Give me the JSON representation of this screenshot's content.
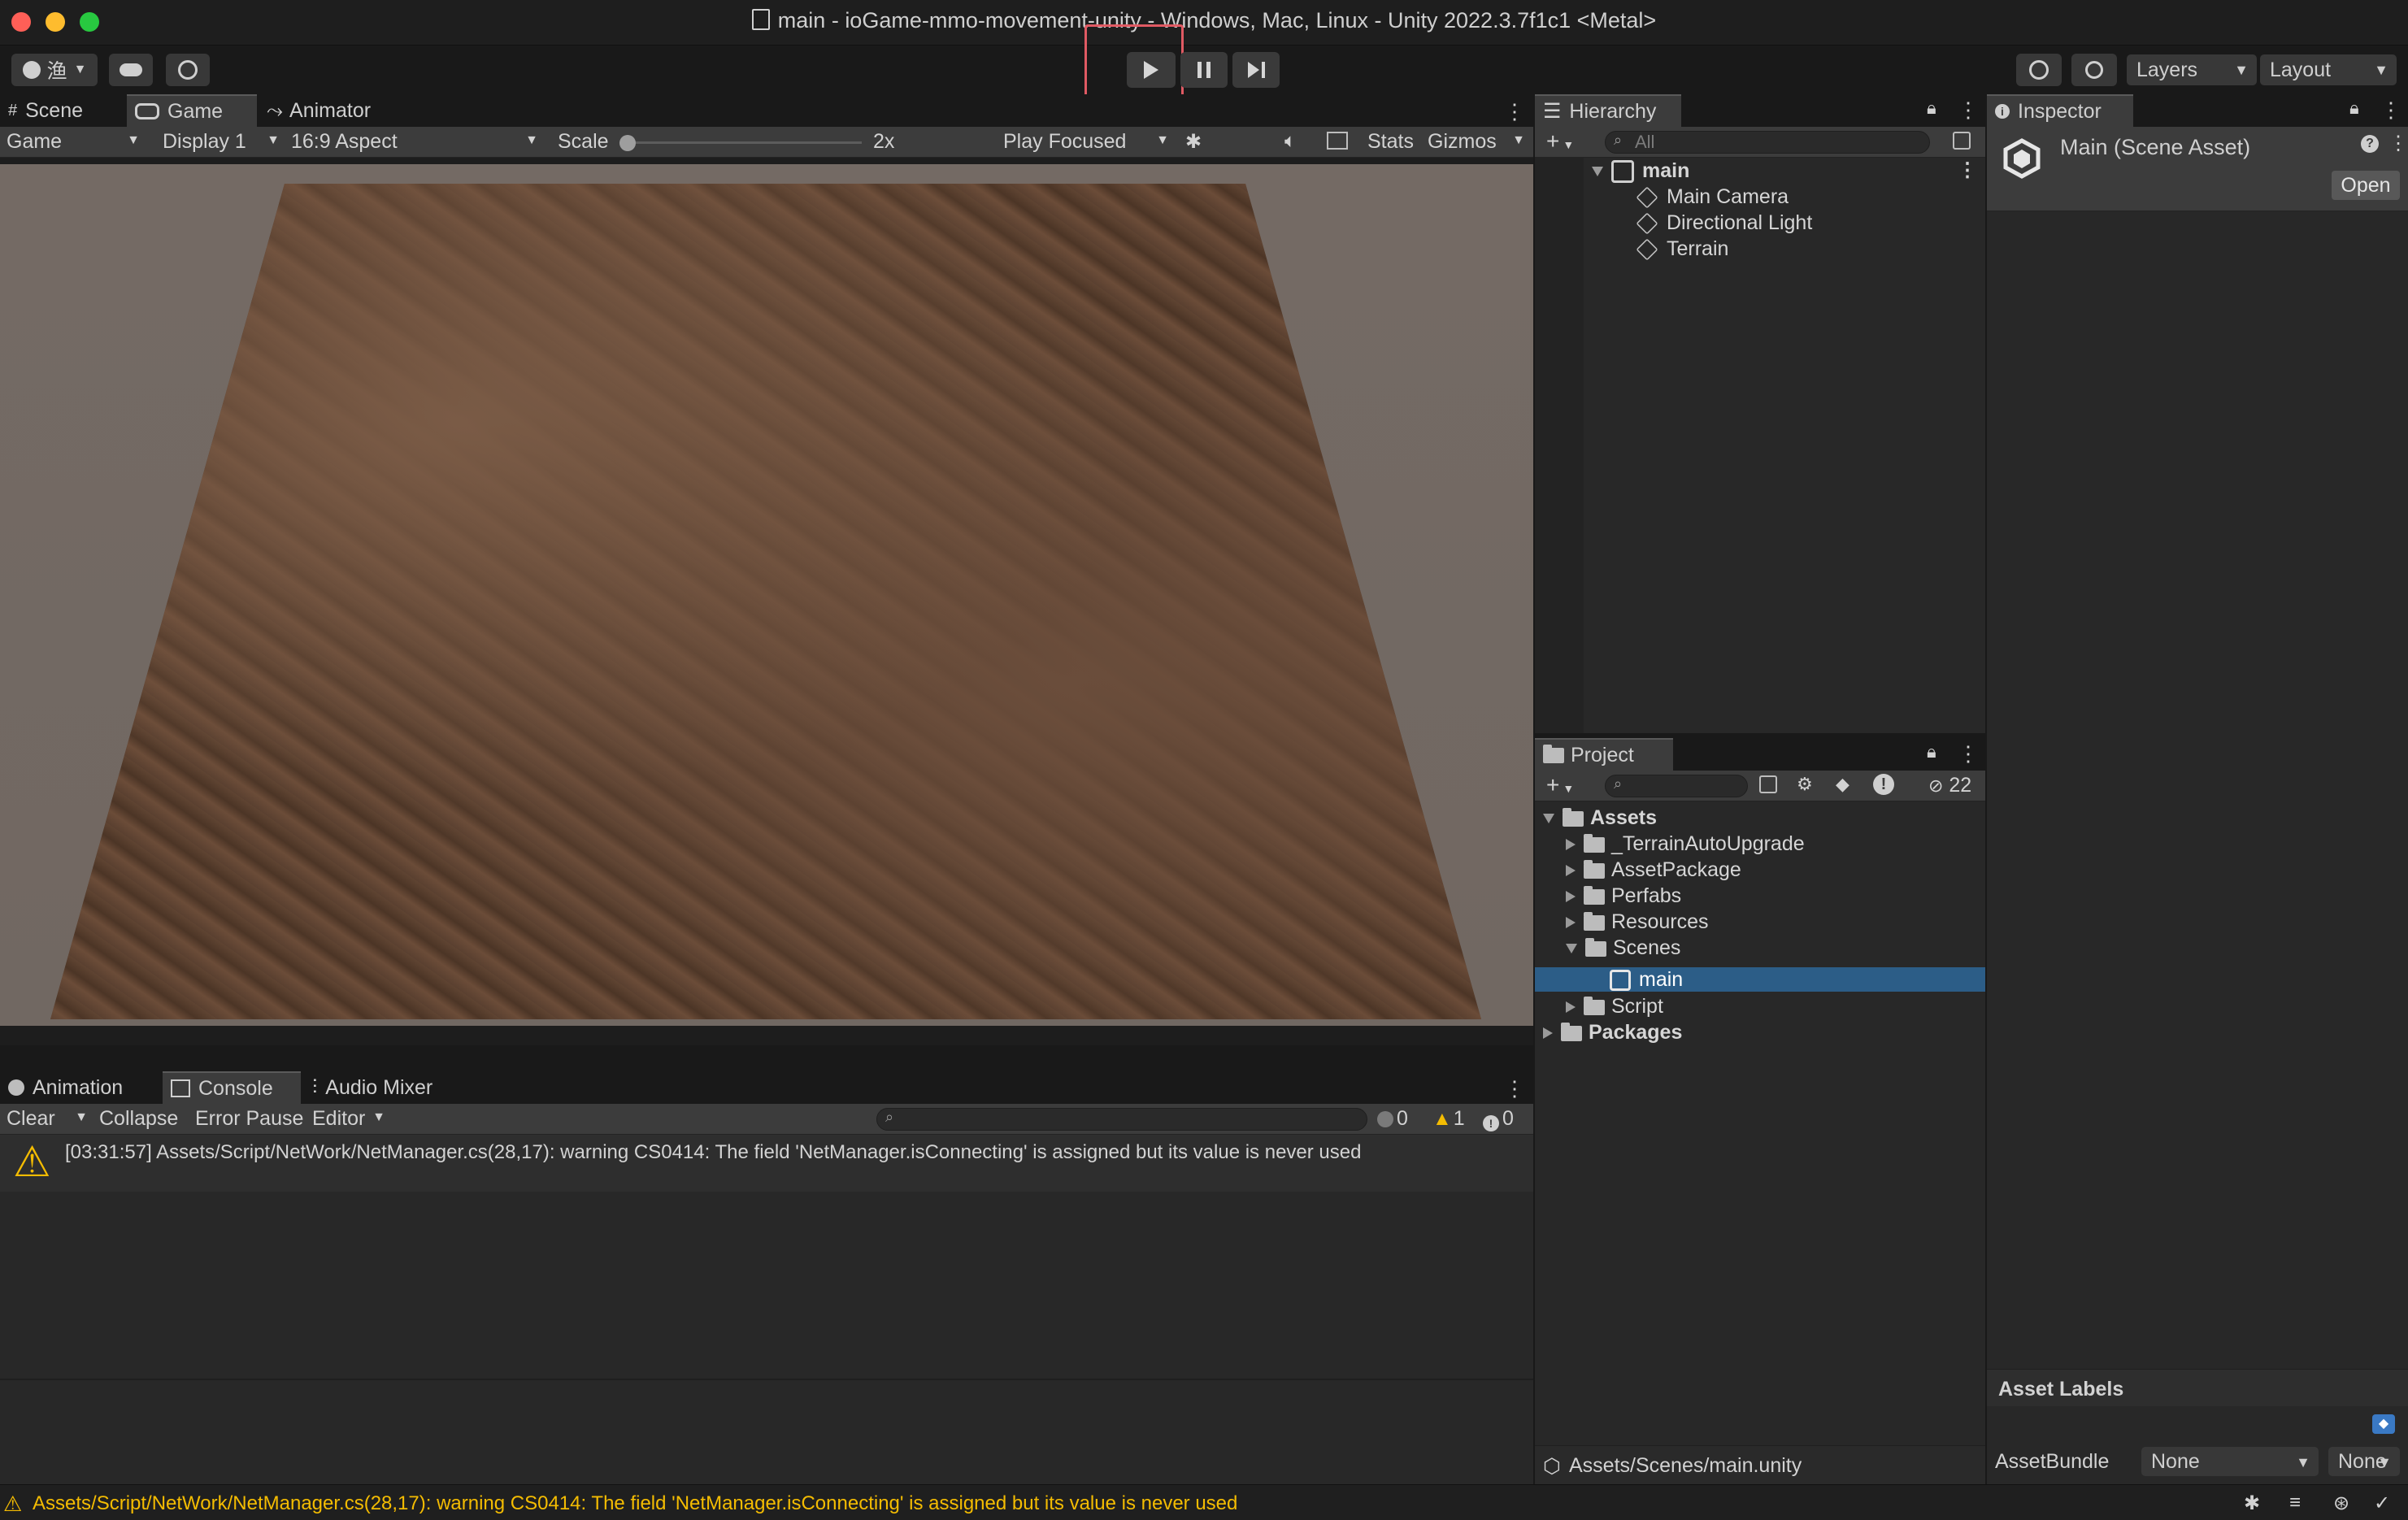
{
  "window": {
    "title": "main - ioGame-mmo-movement-unity - Windows, Mac, Linux - Unity 2022.3.7f1c1 <Metal>"
  },
  "toolbar": {
    "account_label": "渔",
    "layers_label": "Layers",
    "layout_label": "Layout"
  },
  "game_panel": {
    "tabs": [
      "Scene",
      "Game",
      "Animator"
    ],
    "view_select": "Game",
    "display_select": "Display 1",
    "aspect_select": "16:9 Aspect",
    "scale_label": "Scale",
    "scale_value": "2x",
    "play_mode_select": "Play Focused",
    "stats_label": "Stats",
    "gizmos_label": "Gizmos"
  },
  "hierarchy": {
    "tab": "Hierarchy",
    "search_placeholder": "All",
    "scene": "main",
    "items": [
      "Main Camera",
      "Directional Light",
      "Terrain"
    ]
  },
  "inspector": {
    "tab": "Inspector",
    "asset_title": "Main (Scene Asset)",
    "open_label": "Open",
    "asset_labels_heading": "Asset Labels",
    "assetbundle_label": "AssetBundle",
    "assetbundle_value": "None",
    "assetbundle_variant": "None"
  },
  "project": {
    "tab": "Project",
    "hidden_count": "22",
    "root": "Assets",
    "folders": [
      "_TerrainAutoUpgrade",
      "AssetPackage",
      "Perfabs",
      "Resources",
      "Scenes"
    ],
    "selected_scene": "main",
    "after_scenes": "Script",
    "packages": "Packages",
    "path": "Assets/Scenes/main.unity"
  },
  "console": {
    "tabs": [
      "Animation",
      "Console",
      "Audio Mixer"
    ],
    "clear_label": "Clear",
    "collapse_label": "Collapse",
    "error_pause_label": "Error Pause",
    "editor_label": "Editor",
    "log_count": "0",
    "warn_count": "1",
    "error_count": "0",
    "message": "[03:31:57] Assets/Script/NetWork/NetManager.cs(28,17): warning CS0414: The field 'NetManager.isConnecting' is assigned but its value is never used"
  },
  "statusbar": {
    "message": "Assets/Script/NetWork/NetManager.cs(28,17): warning CS0414: The field 'NetManager.isConnecting' is assigned but its value is never used"
  }
}
